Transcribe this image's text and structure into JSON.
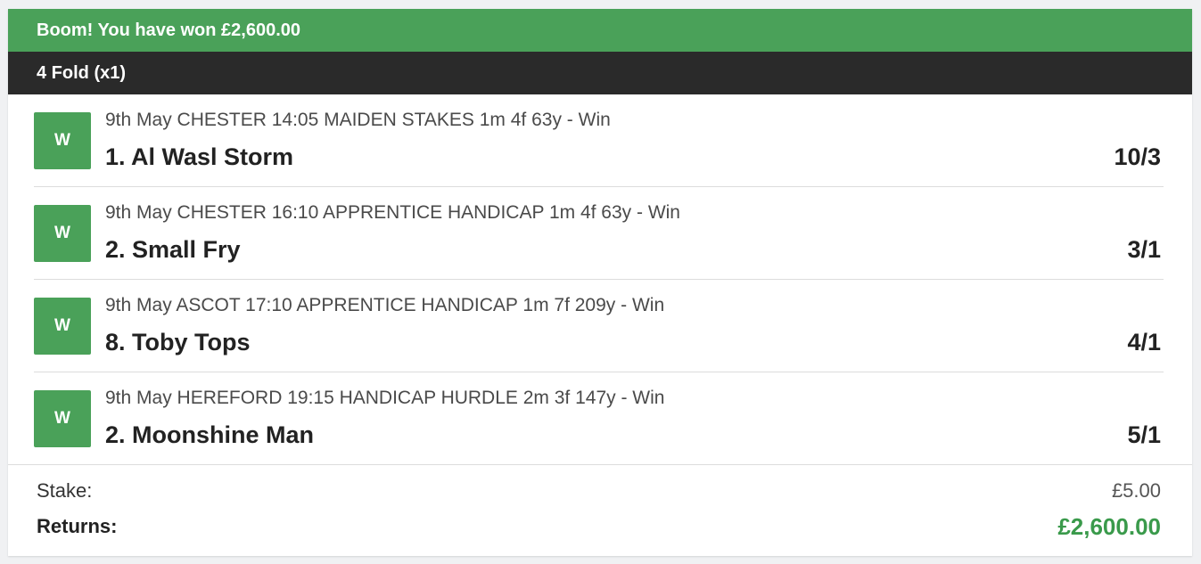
{
  "banner": {
    "text": "Boom! You have won £2,600.00"
  },
  "bet": {
    "type": "4 Fold (x1)"
  },
  "selections": [
    {
      "result": "W",
      "description": "9th May CHESTER 14:05 MAIDEN STAKES 1m 4f 63y - Win",
      "runner": "1. Al Wasl Storm",
      "odds": "10/3"
    },
    {
      "result": "W",
      "description": "9th May CHESTER 16:10 APPRENTICE HANDICAP 1m 4f 63y - Win",
      "runner": "2. Small Fry",
      "odds": "3/1"
    },
    {
      "result": "W",
      "description": "9th May ASCOT 17:10 APPRENTICE HANDICAP 1m 7f 209y - Win",
      "runner": "8. Toby Tops",
      "odds": "4/1"
    },
    {
      "result": "W",
      "description": "9th May HEREFORD 19:15 HANDICAP HURDLE 2m 3f 147y - Win",
      "runner": "2. Moonshine Man",
      "odds": "5/1"
    }
  ],
  "summary": {
    "stake_label": "Stake:",
    "stake_value": "£5.00",
    "returns_label": "Returns:",
    "returns_value": "£2,600.00"
  },
  "colors": {
    "win_green": "#4aa159",
    "header_dark": "#2a2a2a",
    "returns_green": "#3a9a4b"
  }
}
